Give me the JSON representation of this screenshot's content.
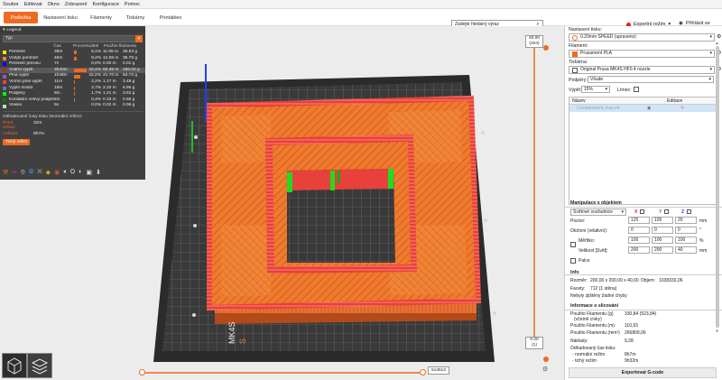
{
  "menu": [
    "Soubor",
    "Editovat",
    "Okno",
    "Zobrazení",
    "Konfigurace",
    "Pomoc"
  ],
  "tabs": [
    "Podložka",
    "Nastavení tisku",
    "Filamenty",
    "Tiskárny",
    "Printables"
  ],
  "search": {
    "placeholder": "Zadejte hledaný výraz"
  },
  "header": {
    "expert_label": "Expertní režim",
    "login_label": "Přihlásit se"
  },
  "legend": {
    "title": "Legend",
    "type_label": "Typ",
    "columns": {
      "time": "Čas",
      "percent": "Procentuálně",
      "used": "Použito filamentu"
    },
    "rows": [
      {
        "name": "Perimetr",
        "time": "39m",
        "pct": 8.1,
        "pct_label": "8,1%",
        "m": "11.95 m",
        "g": "35.63 g",
        "color": "#ffe600"
      },
      {
        "name": "Vnější perimetr",
        "time": "45m",
        "pct": 9.2,
        "pct_label": "9,2%",
        "m": "12.06 m",
        "g": "35.78 g",
        "color": "#ff7d38"
      },
      {
        "name": "Perimetr převisu",
        "time": "7s",
        "pct": 0.0,
        "pct_label": "0,0%",
        "m": "0.00 m",
        "g": "0.01 g",
        "color": "#0000ff"
      },
      {
        "name": "Vnitřní výplň",
        "time": "3h20m",
        "pct": 42.4,
        "pct_label": "42,4%",
        "m": "60.36 m",
        "g": "180.02 g",
        "color": "#b03029"
      },
      {
        "name": "Plná výplň",
        "time": "1h48m",
        "pct": 22.2,
        "pct_label": "22,2%",
        "m": "21.70 m",
        "g": "64.72 g",
        "color": "#9654cc"
      },
      {
        "name": "Vrchní plná výplň",
        "time": "11m",
        "pct": 2.2,
        "pct_label": "2,2%",
        "m": "1.17 m",
        "g": "3.49 g",
        "color": "#f04040"
      },
      {
        "name": "Výplň mostů",
        "time": "18m",
        "pct": 3.7,
        "pct_label": "3,7%",
        "m": "2.33 m",
        "g": "6.95 g",
        "color": "#4d80ba"
      },
      {
        "name": "Podpěry",
        "time": "8m",
        "pct": 1.7,
        "pct_label": "1,7%",
        "m": "1.21 m",
        "g": "3.62 g",
        "color": "#00ff00"
      },
      {
        "name": "Kontaktní vrstvy podpěr",
        "time": "2m",
        "pct": 0.4,
        "pct_label": "0,4%",
        "m": "0.19 m",
        "g": "0.56 g",
        "color": "#008000"
      },
      {
        "name": "Vlasini",
        "time": "5s",
        "pct": 0.0,
        "pct_label": "0,0%",
        "m": "0.02 m",
        "g": "0.06 g",
        "color": "#b3e3ab"
      }
    ],
    "estimated_label": "Odhadované časy tisku (Normální režim):",
    "first_layer_label": "První vrstva:",
    "first_layer_value": "32m",
    "total_label": "Celkem:",
    "total_value": "8h7m",
    "stealth_button": "Tichý režim"
  },
  "viewport": {
    "top_layer_label": "40.00",
    "top_layer_count": "(204)",
    "bottom_layer_label": "0.20",
    "bottom_layer_count": "(1)",
    "horizontal_slider_value": "513512"
  },
  "right_panel": {
    "print_settings_label": "Nastavení tisku:",
    "print_settings_value": "0.20mm SPEED (upraveno)",
    "filament_label": "Filament:",
    "filament_value": "Prusament PLA",
    "printer_label": "Tiskárna:",
    "printer_value": "Original Prusa MK4S HF0.4 nozzle",
    "supports_label": "Podpěry:",
    "supports_value": "Všude",
    "infill_label": "Výplň:",
    "infill_value": "15%",
    "brim_label": "Límec:",
    "object_table": {
      "name_col": "Název",
      "edit_col": "Editace",
      "object_name": "Containment_tray.stl"
    },
    "manipulation": {
      "title": "Manipulace s objektem",
      "coord_value": "Světové souřadnice",
      "axes": [
        "X",
        "Y",
        "Z"
      ],
      "position_label": "Pozice:",
      "position": [
        "125",
        "105",
        "20"
      ],
      "rotation_label": "Otočení (relativní):",
      "rotation": [
        "0",
        "0",
        "0"
      ],
      "scale_label": "Měřítko:",
      "scale": [
        "100",
        "100",
        "100"
      ],
      "size_label": "Velikost [Svět]:",
      "size": [
        "200",
        "200",
        "40"
      ],
      "unit_mm": "mm",
      "unit_deg": "°",
      "unit_pct": "%",
      "inches_label": "Palce"
    },
    "info": {
      "title": "Info",
      "size_label": "Rozměr:",
      "size_value": "200,00 x 200,00 x 40,00",
      "volume_label": "Objem:",
      "volume_value": "1038333,06",
      "facets_label": "Facety:",
      "facets_value": "712 (1 stěna)",
      "errors_value": "Nebyly zjištěny žádné chyby"
    },
    "slicing": {
      "title": "Informace o slicování",
      "g_label": "Použito Filamentu (g)",
      "g_sub": "(včetně cívky)",
      "g_value": "330,84 (523,84)",
      "m_label": "Použito Filamentu (m)",
      "m_value": "110,93",
      "mm3_label": "Použito Filamentu (mm³)",
      "mm3_value": "266809,06",
      "cost_label": "Náklady:",
      "cost_value": "9,28",
      "time_label": "Odhadovaný čas tisku:",
      "normal_label": "- normální režim",
      "normal_value": "8h7m",
      "stealth_label": "- tichý režim",
      "stealth_value": "9h32m"
    },
    "export_button": "Exportovat G-code"
  },
  "colors": {
    "accent": "#ed6b21",
    "perimeter_orange": "#ff7d38",
    "top_solid_red": "#f04040",
    "support_green": "#00ff00"
  }
}
